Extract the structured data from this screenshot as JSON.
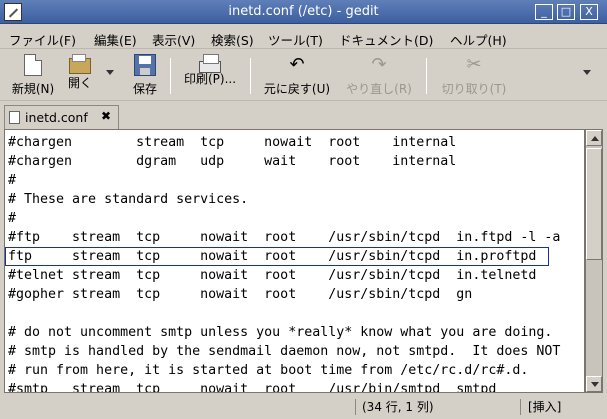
{
  "window": {
    "title": "inetd.conf (/etc) - gedit",
    "min_symbol": "_",
    "max_symbol": "□",
    "close_symbol": "X"
  },
  "menubar": {
    "items": [
      "ファイル(F)",
      "編集(E)",
      "表示(V)",
      "検索(S)",
      "ツール(T)",
      "ドキュメント(D)",
      "ヘルプ(H)"
    ]
  },
  "toolbar": {
    "new_label": "新規(N)",
    "open_label": "開く",
    "save_label": "保存",
    "print_label": "印刷(P)...",
    "undo_label": "元に戻す(U)",
    "redo_label": "やり直し(R)",
    "cut_label": "切り取り(T)",
    "undo_glyph": "↶",
    "redo_glyph": "↷",
    "cut_glyph": "✂"
  },
  "tab": {
    "label": "inetd.conf",
    "close_glyph": "✖"
  },
  "editor": {
    "lines": [
      "#chargen        stream  tcp     nowait  root    internal",
      "#chargen        dgram   udp     wait    root    internal",
      "#",
      "# These are standard services.",
      "#",
      "#ftp    stream  tcp     nowait  root    /usr/sbin/tcpd  in.ftpd -l -a",
      "ftp     stream  tcp     nowait  root    /usr/sbin/tcpd  in.proftpd",
      "#telnet stream  tcp     nowait  root    /usr/sbin/tcpd  in.telnetd",
      "#gopher stream  tcp     nowait  root    /usr/sbin/tcpd  gn",
      "",
      "# do not uncomment smtp unless you *really* know what you are doing.",
      "# smtp is handled by the sendmail daemon now, not smtpd.  It does NOT",
      "# run from here, it is started at boot time from /etc/rc.d/rc#.d.",
      "#smtp   stream  tcp     nowait  root    /usr/bin/smtpd  smtpd"
    ]
  },
  "statusbar": {
    "position": "(34 行, 1 列)",
    "mode": "[挿入]"
  }
}
